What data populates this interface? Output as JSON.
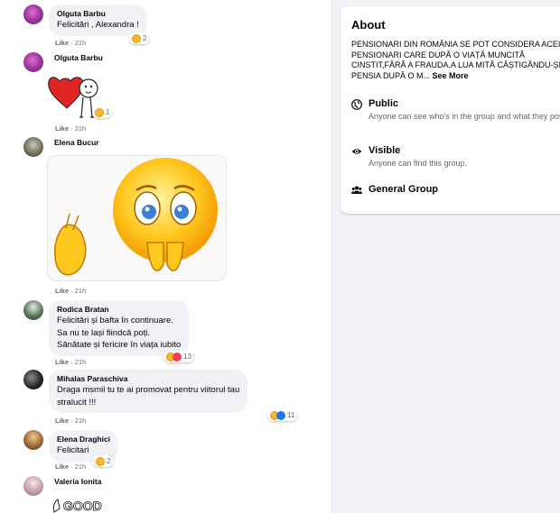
{
  "comments": [
    {
      "author": "Olguta Barbu",
      "lines": [
        "Felicitări , Alexandra !"
      ],
      "time": "21h",
      "like_label": "Like",
      "reaction_count": "2"
    },
    {
      "author": "Olguta Barbu",
      "lines": [],
      "time": "21h",
      "like_label": "Like",
      "reaction_count": "1"
    },
    {
      "author": "Elena Bucur",
      "lines": [],
      "time": "21h",
      "like_label": "Like",
      "reaction_count": ""
    },
    {
      "author": "Rodica Bratan",
      "lines": [
        "Felicitări și bafta în continuare.",
        "Sa nu te lași fiindcă poți.",
        "Sănătate și fericire în viața iubito"
      ],
      "time": "21h",
      "like_label": "Like",
      "reaction_count": "13"
    },
    {
      "author": "Mihalas Paraschiva",
      "lines": [
        "Draga msmii tu te ai promovat pentru viitorul tau",
        "stralucit !!!"
      ],
      "time": "21h",
      "like_label": "Like",
      "reaction_count": "11"
    },
    {
      "author": "Elena Draghici",
      "lines": [
        "Felicitari"
      ],
      "time": "21h",
      "like_label": "Like",
      "reaction_count": "2"
    },
    {
      "author": "Valeria Ionita",
      "lines": [],
      "time": "",
      "like_label": "",
      "reaction_count": ""
    }
  ],
  "separator": "·",
  "sticker_good_text": "GOOD",
  "about": {
    "title": "About",
    "description": "PENSIONARI DIN ROMÂNIA SE POT CONSIDERA ACEI PENSIONARI CARE DUPĂ O VIAȚĂ MUNCITĂ CINSTIT,FĂRĂ A FRAUDA,A LUA MITĂ CĂȘTIGÂNDU-ȘI PENSIA DUPĂ O M...",
    "see_more": "See More",
    "public_title": "Public",
    "public_sub": "Anyone can see who's in the group and what they post",
    "visible_title": "Visible",
    "visible_sub": "Anyone can find this group.",
    "general_group": "General Group"
  },
  "icons": {
    "public": "globe-icon",
    "visible": "eye-icon",
    "group": "people-icon"
  },
  "colors": {
    "page_bg": "#f0f2f5",
    "bubble_bg": "#f0f2f5",
    "meta_text": "#65676b",
    "like_blue": "#1877f2",
    "haha_yellow": "#f7b928",
    "love_red": "#f33e58"
  }
}
